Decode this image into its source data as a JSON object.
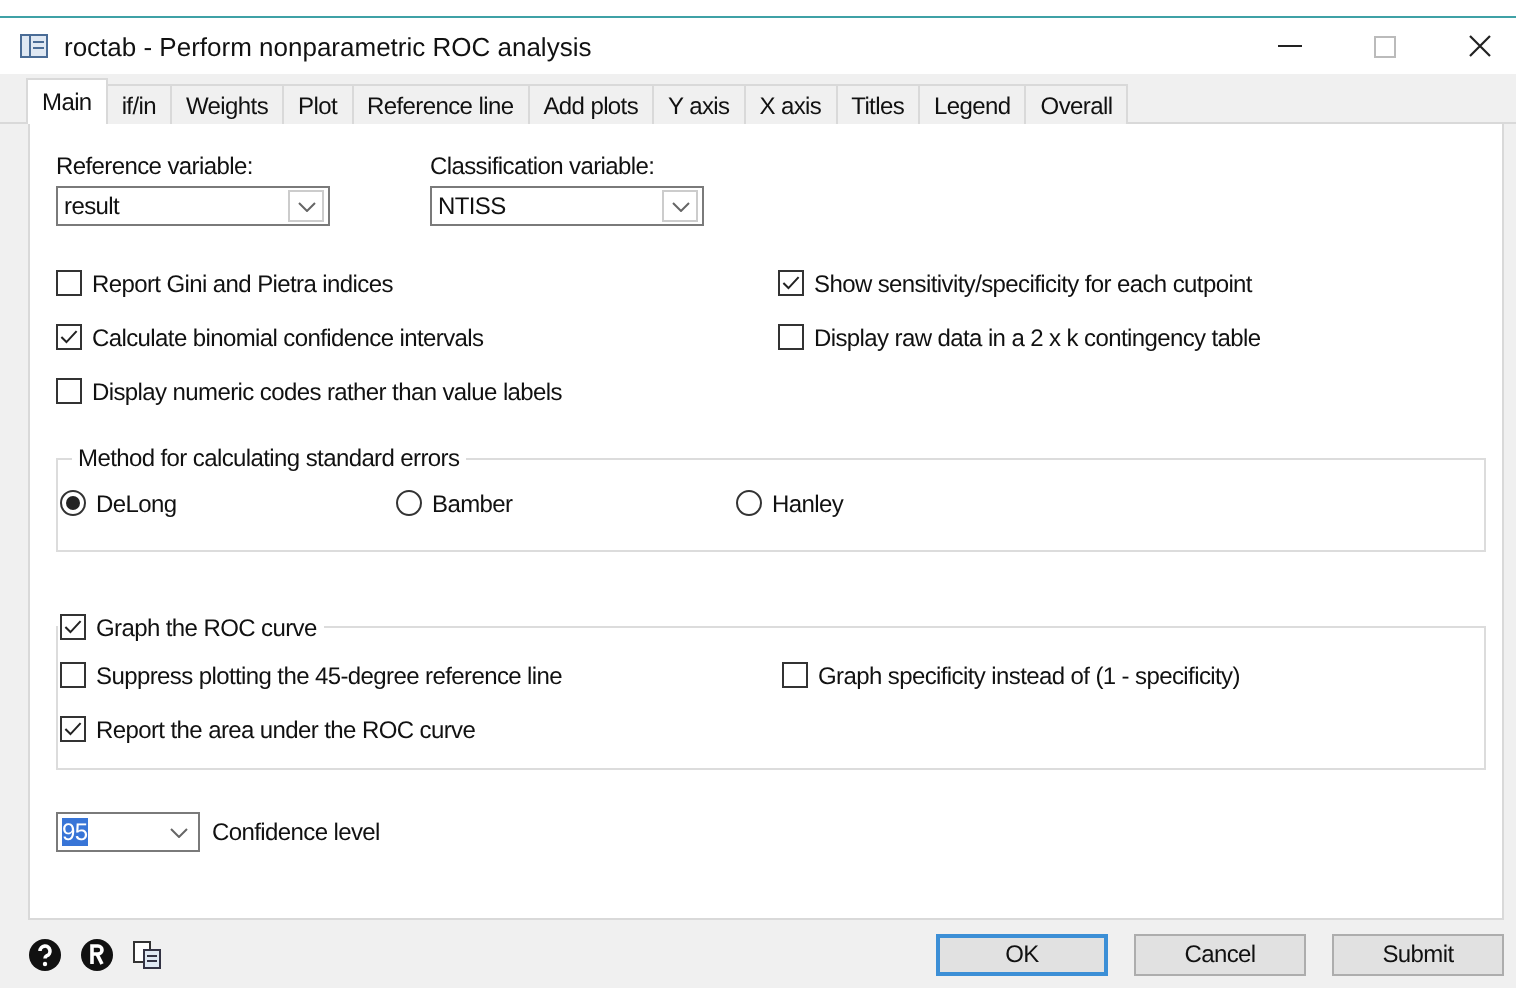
{
  "window": {
    "title": "roctab - Perform nonparametric ROC analysis"
  },
  "tabs": [
    {
      "label": "Main",
      "selected": true
    },
    {
      "label": "if/in",
      "selected": false
    },
    {
      "label": "Weights",
      "selected": false
    },
    {
      "label": "Plot",
      "selected": false
    },
    {
      "label": "Reference line",
      "selected": false
    },
    {
      "label": "Add plots",
      "selected": false
    },
    {
      "label": "Y axis",
      "selected": false
    },
    {
      "label": "X axis",
      "selected": false
    },
    {
      "label": "Titles",
      "selected": false
    },
    {
      "label": "Legend",
      "selected": false
    },
    {
      "label": "Overall",
      "selected": false
    }
  ],
  "fields": [
    {
      "label": "Reference variable:",
      "value": "result"
    },
    {
      "label": "Classification variable:",
      "value": "NTISS"
    }
  ],
  "options": [
    {
      "label": "Report Gini and Pietra indices",
      "checked": false
    },
    {
      "label": "Show sensitivity/specificity for each cutpoint",
      "checked": true
    },
    {
      "label": "Calculate binomial confidence intervals",
      "checked": true
    },
    {
      "label": "Display raw data in a 2 x k contingency table",
      "checked": false
    },
    {
      "label": "Display numeric codes rather than value labels",
      "checked": false
    }
  ],
  "standard_errors": {
    "title": "Method for calculating standard errors",
    "methods": [
      {
        "label": "DeLong",
        "selected": true
      },
      {
        "label": "Bamber",
        "selected": false
      },
      {
        "label": "Hanley",
        "selected": false
      }
    ]
  },
  "graph": {
    "label": "Graph the ROC curve",
    "checked": true,
    "options": [
      {
        "label": "Suppress plotting the 45-degree reference line",
        "checked": false
      },
      {
        "label": "Graph specificity instead of (1 - specificity)",
        "checked": false
      },
      {
        "label": "Report the area under the ROC curve",
        "checked": true
      }
    ]
  },
  "confidence": {
    "value": "95",
    "label": "Confidence level"
  },
  "buttons": [
    {
      "label": "OK",
      "default": true
    },
    {
      "label": "Cancel",
      "default": false
    },
    {
      "label": "Submit",
      "default": false
    }
  ]
}
